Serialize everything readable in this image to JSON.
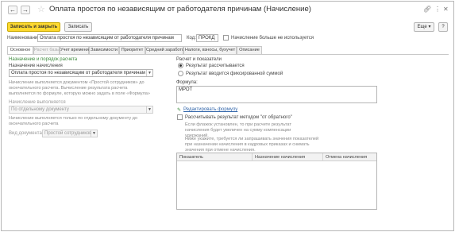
{
  "window": {
    "title": "Оплата простоя по независящим от работодателя причинам (Начисление)",
    "back_icon": "←",
    "forward_icon": "→",
    "star_icon": "☆"
  },
  "toolbar": {
    "save_close": "Записать и закрыть",
    "save": "Записать",
    "more": "Еще",
    "help": "?"
  },
  "header": {
    "name_label": "Наименование:",
    "name_value": "Оплата простоя по независящим от работодателя причинам",
    "code_label": "Код:",
    "code_value": "ПРОКД",
    "unused_label": "Начисление больше не используется"
  },
  "tabs": [
    {
      "label": "Основное"
    },
    {
      "label": "Расчет базы"
    },
    {
      "label": "Учет времени"
    },
    {
      "label": "Зависимости"
    },
    {
      "label": "Приоритет"
    },
    {
      "label": "Средний заработок"
    },
    {
      "label": "Налоги, взносы, бухучет"
    },
    {
      "label": "Описание"
    }
  ],
  "left": {
    "section_title": "Назначение и порядок расчета",
    "purpose_label": "Назначение начисления",
    "purpose_value": "Оплата простоя по независящим от работодателя причинам",
    "note1": "Начисление выполняется документом «Простой сотрудников» до окончательного расчета. Вычисление результата расчета выполняется по формуле, которую можно задать в поле «Формула»",
    "performed_label": "Начисление выполняется",
    "performed_value": "По отдельному документу",
    "note2": "Начисление выполняется только по отдельному документу до окончательного расчета",
    "doctype_label": "Вид документа:",
    "doctype_value": "Простой сотрудников"
  },
  "right": {
    "section_title": "Расчет и показатели",
    "radio1": "Результат рассчитывается",
    "radio2": "Результат вводится фиксированной суммой",
    "formula_label": "Формула:",
    "formula_value": "МРОТ",
    "edit_formula": "Редактировать формулу",
    "reverse_label": "Рассчитывать результат методом \"от обратного\"",
    "note3": "Если флажок установлен, то при расчете результат начисления будет увеличен на сумму компенсации удержаний.",
    "note4": "Ниже укажите, требуется ли запрашивать значения показателей при назначении начисления в кадровых приказах и снимать значения при отмене начисления.",
    "table_headers": [
      "Показатель",
      "Назначение начисления",
      "Отмена начисления"
    ]
  }
}
